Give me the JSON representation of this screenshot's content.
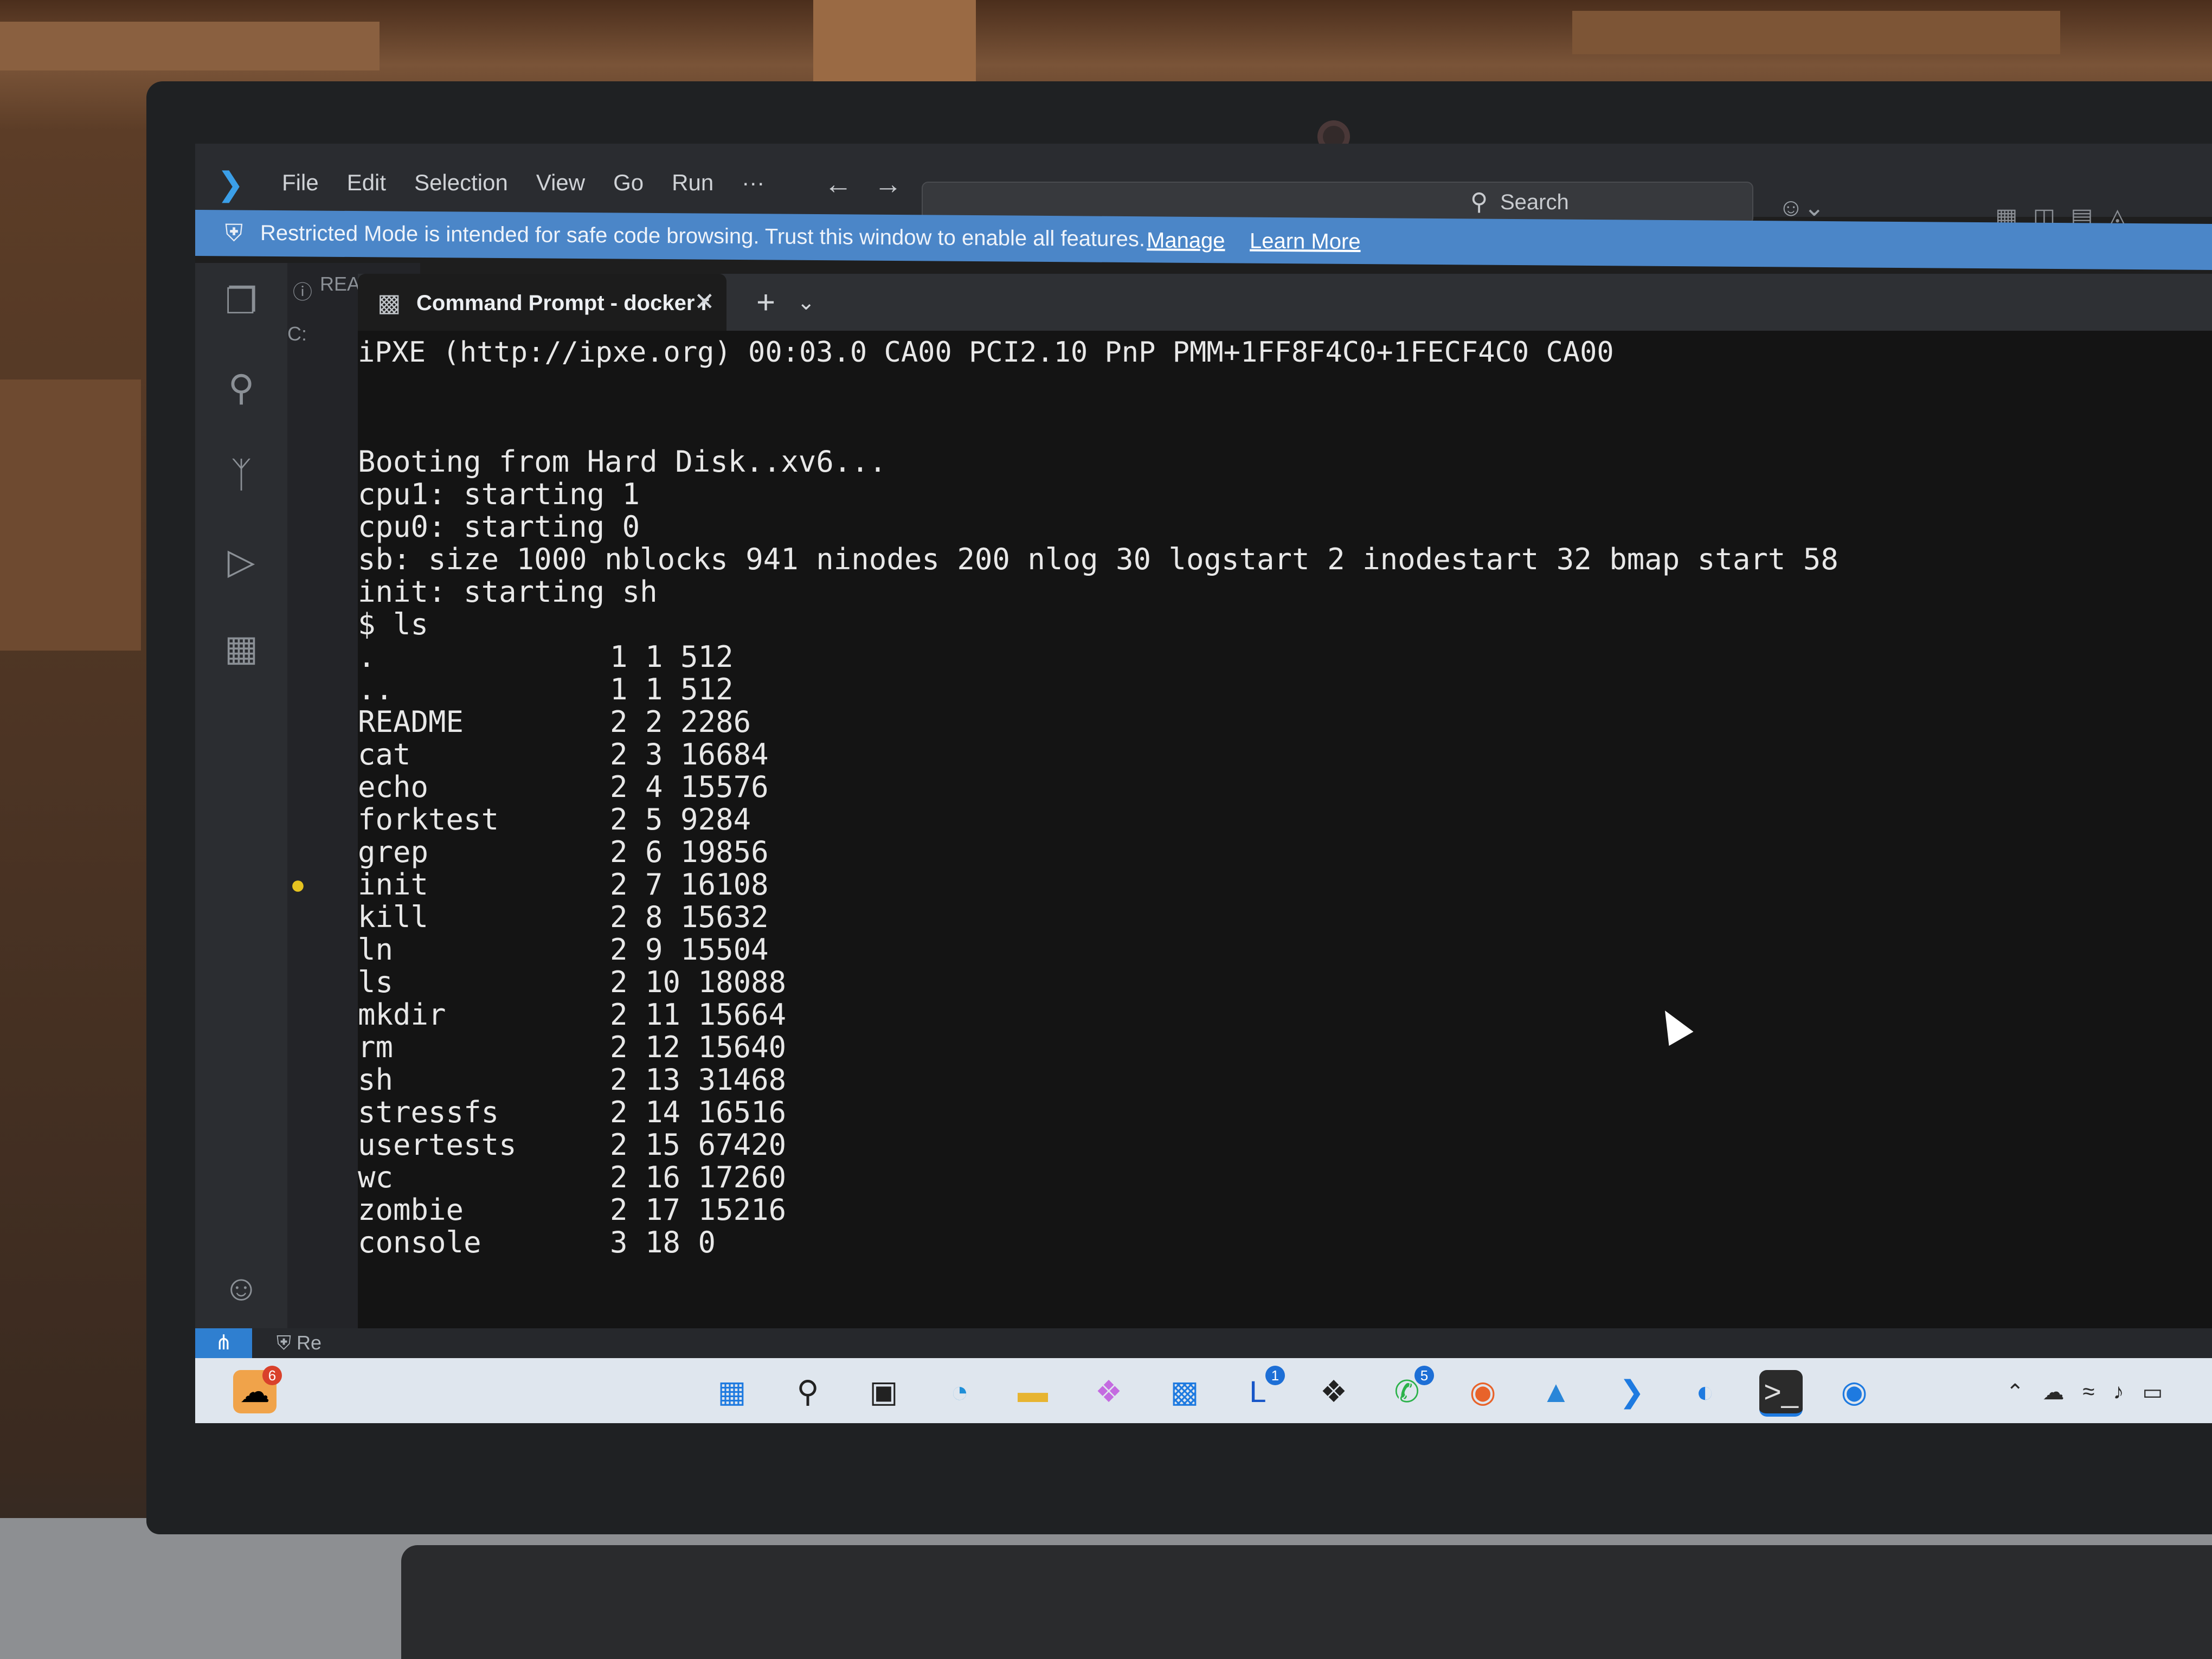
{
  "titlebar": {
    "menu": [
      "File",
      "Edit",
      "Selection",
      "View",
      "Go",
      "Run",
      "···"
    ],
    "search_placeholder": "Search"
  },
  "banner": {
    "message": "Restricted Mode is intended for safe code browsing. Trust this window to enable all features.",
    "manage": "Manage",
    "learn_more": "Learn More",
    "color": "#4b86c8"
  },
  "editor": {
    "ghost_tab": "README",
    "ghost_letter": "C:"
  },
  "terminal_tab": {
    "label": "Command Prompt - docker r",
    "close": "✕",
    "plus": "+",
    "chevron": "⌄"
  },
  "terminal": {
    "header": "iPXE (http://ipxe.org) 00:03.0 CA00 PCI2.10 PnP PMM+1FF8F4C0+1FECF4C0 CA00",
    "boot_lines": [
      "Booting from Hard Disk..xv6...",
      "cpu1: starting 1",
      "cpu0: starting 0",
      "sb: size 1000 nblocks 941 ninodes 200 nlog 30 logstart 2 inodestart 32 bmap start 58",
      "init: starting sh",
      "$ ls"
    ],
    "ls": [
      {
        "name": ".",
        "meta": "1 1 512"
      },
      {
        "name": "..",
        "meta": "1 1 512"
      },
      {
        "name": "README",
        "meta": "2 2 2286"
      },
      {
        "name": "cat",
        "meta": "2 3 16684"
      },
      {
        "name": "echo",
        "meta": "2 4 15576"
      },
      {
        "name": "forktest",
        "meta": "2 5 9284"
      },
      {
        "name": "grep",
        "meta": "2 6 19856"
      },
      {
        "name": "init",
        "meta": "2 7 16108"
      },
      {
        "name": "kill",
        "meta": "2 8 15632"
      },
      {
        "name": "ln",
        "meta": "2 9 15504"
      },
      {
        "name": "ls",
        "meta": "2 10 18088"
      },
      {
        "name": "mkdir",
        "meta": "2 11 15664"
      },
      {
        "name": "rm",
        "meta": "2 12 15640"
      },
      {
        "name": "sh",
        "meta": "2 13 31468"
      },
      {
        "name": "stressfs",
        "meta": "2 14 16516"
      },
      {
        "name": "usertests",
        "meta": "2 15 67420"
      },
      {
        "name": "wc",
        "meta": "2 16 17260"
      },
      {
        "name": "zombie",
        "meta": "2 17 15216"
      },
      {
        "name": "console",
        "meta": "3 18 0"
      }
    ]
  },
  "statusbar": {
    "restricted": "Re"
  },
  "taskbar": {
    "widgets_badge": "6",
    "todo_badge": "1",
    "whatsapp_badge": "5"
  }
}
